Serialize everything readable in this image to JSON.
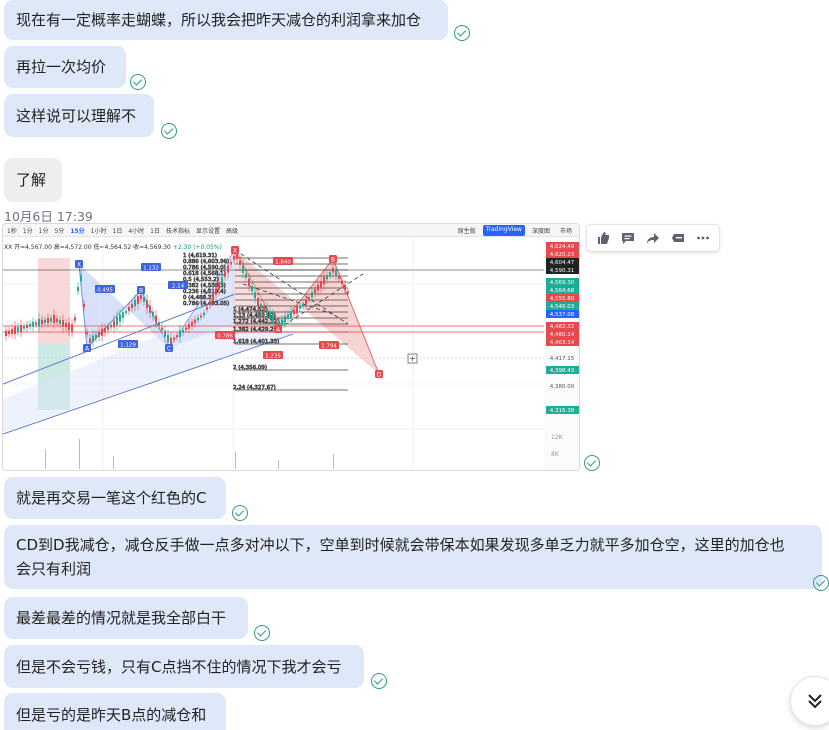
{
  "messages": {
    "m1": "现在有一定概率走蝴蝶，所以我会把昨天减仓的利润拿来加仓",
    "m2": "再拉一次均价",
    "m3": "这样说可以理解不",
    "m4": "了解",
    "timestamp": "10月6日 17:39",
    "m5": "就是再交易一笔这个红色的C",
    "m6a": "CD到D我减仓，减仓反手做一点多对冲以下，空单到时候就会带保本如果发现多单乏力就平多加仓空，这里的加仓也",
    "m6b": "会只有利润",
    "m7": "最差最差的情况就是我全部白干",
    "m8": "但是不会亏钱，只有C点挡不住的情况下我才会亏",
    "m9": "但是亏的是昨天B点的减仓和"
  },
  "chart": {
    "toolbar": {
      "timeframes": [
        "1秒",
        "1分",
        "1分",
        "5分",
        "15分",
        "1小时",
        "1日",
        "4小时",
        "1日"
      ],
      "active": "15分",
      "tools": "技术指标",
      "settings": "显示设置",
      "advanced": "高级",
      "views": [
        "原生版",
        "TradingView",
        "深度图",
        "市场"
      ]
    },
    "header": {
      "symbol": "XX",
      "ohlc": "开=4,567.00 高=4,572.00 低=4,564.52 收=4,569.30",
      "change": "+2.30 (+0.05%)",
      "sub": "5.89 (+1.21%)"
    },
    "fib_levels": [
      {
        "label": "1 (4,619.31)"
      },
      {
        "label": "0.886 (4,603.96)"
      },
      {
        "label": "0.786 (4,590.0)"
      },
      {
        "label": "0.618 (4,568.1)"
      },
      {
        "label": "0.5 (4,553.2)"
      },
      {
        "label": "0.382 (4,538.3)"
      },
      {
        "label": "0.236 (4,519.4)"
      },
      {
        "label": "0 (4,488.3)"
      },
      {
        "label": "0.786 (4,493.05)"
      },
      {
        "label": "1 (4,474.52)"
      },
      {
        "label": "1.13 (4,459.12)"
      },
      {
        "label": "1.272 (4,442.31)"
      },
      {
        "label": "1.382 (4,429.29)"
      },
      {
        "label": "1.618 (4,401.33)"
      },
      {
        "label": "2 (4,356.09)"
      },
      {
        "label": "2.24 (4,327.67)"
      }
    ],
    "pattern_points": [
      "X",
      "A",
      "B",
      "C",
      "D"
    ],
    "ratios": [
      "1.132",
      "0.495",
      "2.14",
      "1.129",
      "0.786",
      "1.840",
      "1.235",
      "1.794"
    ],
    "price_axis": [
      {
        "label": "4,624.49",
        "color": "#e5484d"
      },
      {
        "label": "4,620.23",
        "color": "#e5484d"
      },
      {
        "label": "4,604.47",
        "color": "#222222"
      },
      {
        "label": "4,590.31",
        "color": "#222222"
      },
      {
        "label": "4,569.30",
        "color": "#22ab94"
      },
      {
        "label": "4,564.68",
        "color": "#22ab94"
      },
      {
        "label": "4,555.80",
        "color": "#e5484d"
      },
      {
        "label": "4,546.03",
        "color": "#22ab94"
      },
      {
        "label": "4,537.08",
        "color": "#2962ff"
      },
      {
        "label": "4,482.32",
        "color": "#e5484d"
      },
      {
        "label": "4,480.14",
        "color": "#e5484d"
      },
      {
        "label": "4,463.14",
        "color": "#e5484d"
      },
      {
        "label": "4,417.15",
        "color": "#ffffff"
      },
      {
        "label": "4,398.43",
        "color": "#22ab94"
      },
      {
        "label": "4,380.00",
        "color": "#ffffff"
      },
      {
        "label": "4,316.38",
        "color": "#22ab94"
      }
    ],
    "volume_axis": [
      "12K",
      "8K"
    ]
  },
  "actions": {
    "like_icon": "thumbs-up-icon",
    "comment_icon": "comment-icon",
    "share_icon": "share-icon",
    "quote_icon": "quote-icon",
    "more_icon": "more-icon"
  }
}
